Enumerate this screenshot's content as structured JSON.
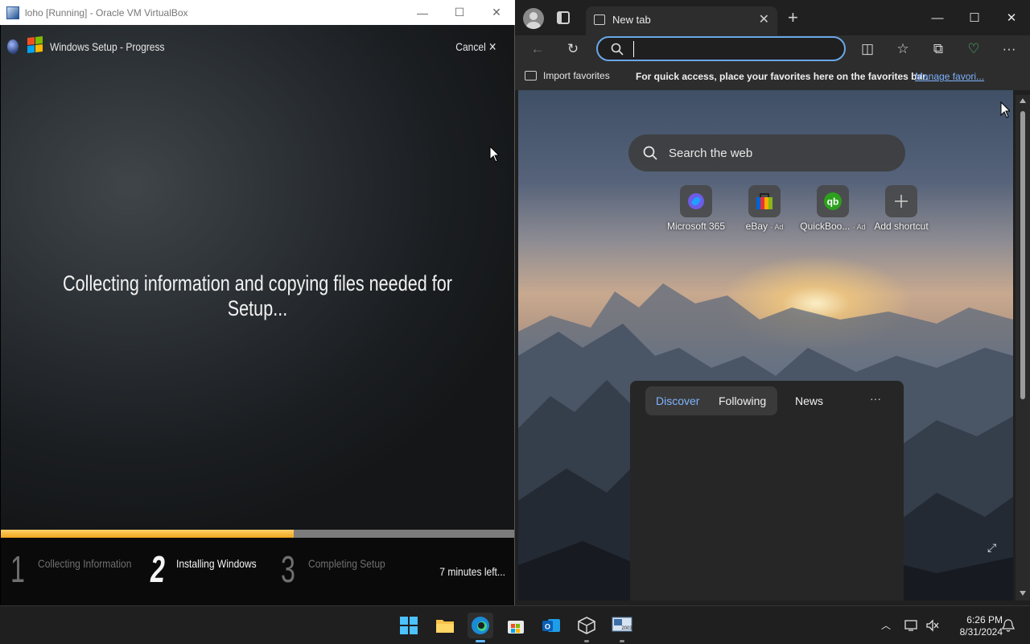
{
  "vbox": {
    "title": "loho [Running] - Oracle VM VirtualBox",
    "controls": {
      "minimize": "—",
      "maximize": "☐",
      "close": "✕"
    }
  },
  "setup": {
    "title": "Windows Setup - Progress",
    "cancel": "Cancel  ✕",
    "message": "Collecting information and copying files needed for Setup...",
    "progress": 0.57,
    "progress_color": "#f0a51d",
    "steps": [
      {
        "num": "1",
        "label": "Collecting Information",
        "state": "done"
      },
      {
        "num": "2",
        "label": "Installing Windows",
        "state": "active"
      },
      {
        "num": "3",
        "label": "Completing Setup",
        "state": "pending"
      }
    ],
    "time_left": "7 minutes left..."
  },
  "edge": {
    "tab_label": "New tab",
    "tab_close": "✕",
    "new_tab": "+",
    "controls": {
      "minimize": "—",
      "maximize": "☐",
      "close": "✕"
    },
    "address_placeholder": "",
    "favorites_bar": {
      "import": "Import favorites",
      "hint": "For quick access, place your favorites here on the favorites bar.",
      "manage": "Manage favori..."
    },
    "search_placeholder": "Search the web",
    "shortcuts": [
      {
        "name": "Microsoft 365",
        "ad": "",
        "icon": "microsoft-365-icon"
      },
      {
        "name": "eBay",
        "ad": "· Ad",
        "icon": "ebay-icon"
      },
      {
        "name": "QuickBoo...",
        "ad": "· Ad",
        "icon": "quickbooks-icon"
      },
      {
        "name": "Add shortcut",
        "ad": "",
        "icon": "plus-icon"
      }
    ],
    "feed_tabs": {
      "discover": "Discover",
      "following": "Following",
      "news": "News",
      "more": "···"
    },
    "accent": "#7fb4ff"
  },
  "taskbar": {
    "apps": [
      "start",
      "file-explorer",
      "edge",
      "microsoft-store",
      "outlook",
      "virtualbox",
      "vm-2003"
    ],
    "time": "6:26 PM",
    "date": "8/31/2024"
  }
}
